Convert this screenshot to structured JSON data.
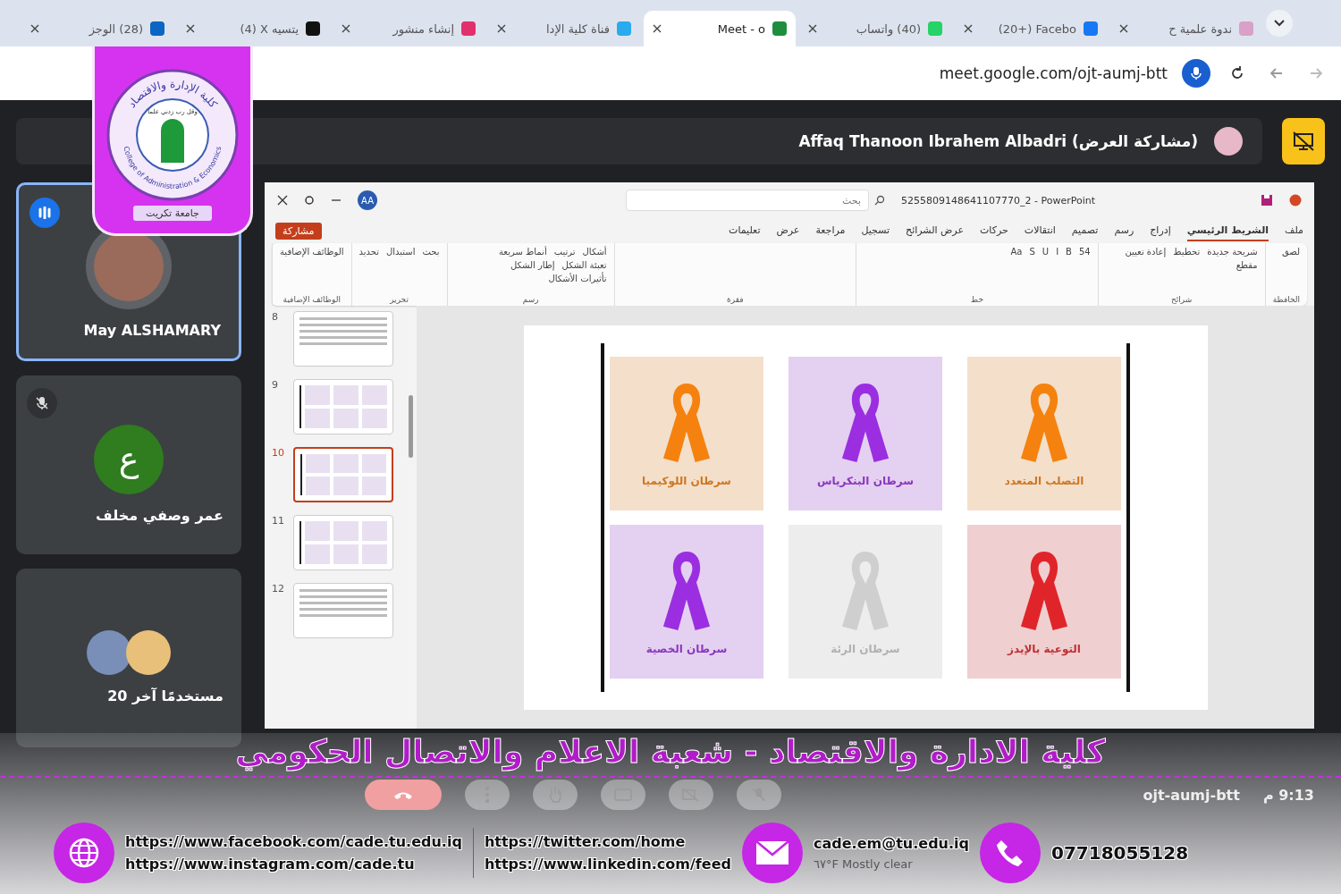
{
  "browser": {
    "tabs": [
      {
        "title": "ندوة علمية ح",
        "color": "#d9a0c8",
        "selected": false
      },
      {
        "title": "(20+) Facebo",
        "color": "#1877f2",
        "selected": false
      },
      {
        "title": "(40) واتساب",
        "color": "#25d366",
        "selected": false
      },
      {
        "title": "Meet - o",
        "color": "#1e8e3e",
        "selected": true
      },
      {
        "title": "فناة كلية الإدا",
        "color": "#2aabee",
        "selected": false
      },
      {
        "title": "إنشاء منشور",
        "color": "#e1306c",
        "selected": false
      },
      {
        "title": "(4) X يتسيه",
        "color": "#111111",
        "selected": false
      },
      {
        "title": "(28) الوجز",
        "color": "#0a66c2",
        "selected": false
      }
    ],
    "url": "meet.google.com/ojt-aumj-btt"
  },
  "logo": {
    "arc_top": "كلية الإدارة والاقتصاد",
    "arc_bottom": "College of Administration & Economics",
    "motto": "وقل رب زدني علما",
    "caption": "جامعة تكريت"
  },
  "meet": {
    "presenter": "Affaq Thanoon Ibrahem Albadri (مشاركة العرض)",
    "participants": [
      {
        "kind": "photo",
        "name": "May ALSHAMARY",
        "speaking": true,
        "muted": false
      },
      {
        "kind": "letter",
        "name": "عمر وصفي مخلف",
        "letter": "ع",
        "speaking": false,
        "muted": true
      },
      {
        "kind": "group",
        "name": "20 مستخدمًا آخر",
        "speaking": false,
        "muted": false
      }
    ],
    "meeting_code": "ojt-aumj-btt",
    "time": "9:13 م"
  },
  "powerpoint": {
    "title": "5255809148641107770_2 - PowerPoint",
    "avatar": "AA",
    "search": {
      "placeholder": "بحث"
    },
    "share": "مشاركة",
    "tabs": [
      {
        "label": "ملف",
        "selected": false
      },
      {
        "label": "الشريط الرئيسي",
        "selected": true
      },
      {
        "label": "إدراج",
        "selected": false
      },
      {
        "label": "رسم",
        "selected": false
      },
      {
        "label": "تصميم",
        "selected": false
      },
      {
        "label": "انتقالات",
        "selected": false
      },
      {
        "label": "حركات",
        "selected": false
      },
      {
        "label": "عرض الشرائح",
        "selected": false
      },
      {
        "label": "تسجيل",
        "selected": false
      },
      {
        "label": "مراجعة",
        "selected": false
      },
      {
        "label": "عرض",
        "selected": false
      },
      {
        "label": "تعليمات",
        "selected": false
      }
    ],
    "groups": [
      {
        "name": "الحافظة",
        "tools": [
          "لصق"
        ]
      },
      {
        "name": "شرائح",
        "tools": [
          "شريحة جديدة",
          "تخطيط",
          "إعادة تعيين",
          "مقطع"
        ]
      },
      {
        "name": "خط",
        "tools": [
          "54",
          "B",
          "I",
          "U",
          "S",
          "Aa"
        ]
      },
      {
        "name": "فقرة"
      },
      {
        "name": "رسم",
        "tools": [
          "أشكال",
          "ترتيب",
          "أنماط سريعة",
          "تعبئة الشكل",
          "إطار الشكل",
          "تأثيرات الأشكال"
        ]
      },
      {
        "name": "تحرير",
        "tools": [
          "بحث",
          "استبدال",
          "تحديد"
        ]
      },
      {
        "name": "الوظائف الإضافية",
        "tools": [
          "الوظائف الإضافية"
        ]
      }
    ],
    "thumbnails": [
      {
        "number": "8",
        "kind": "text",
        "selected": false
      },
      {
        "number": "9",
        "kind": "tiles",
        "selected": false
      },
      {
        "number": "10",
        "kind": "tiles",
        "selected": true
      },
      {
        "number": "11",
        "kind": "tiles",
        "selected": false
      },
      {
        "number": "12",
        "kind": "text",
        "selected": false
      }
    ],
    "slide": {
      "tiles": [
        {
          "label": "التصلب المتعدد",
          "color": "#f5820f"
        },
        {
          "label": "سرطان البنكرياس",
          "color": "#9a2ee0"
        },
        {
          "label": "سرطان اللوكيميا",
          "color": "#f5820f"
        },
        {
          "label": "التوعية بالإيدز",
          "color": "#e0252a"
        },
        {
          "label": "سرطان الرئة",
          "color": "#cfcfcf"
        },
        {
          "label": "سرطان الخصية",
          "color": "#9a2ee0"
        }
      ]
    }
  },
  "overlay": {
    "title": "كلية الادارة والاقتصاد - شعبة الاعلام  والاتصال الحكومي",
    "links_left": [
      "https://www.facebook.com/cade.tu.edu.iq",
      "https://www.instagram.com/cade.tu"
    ],
    "links_right": [
      "https://twitter.com/home",
      "https://www.linkedin.com/feed"
    ],
    "email": "cade.em@tu.edu.iq",
    "phone": "07718055128",
    "weather": "٦٧°F Mostly clear"
  }
}
